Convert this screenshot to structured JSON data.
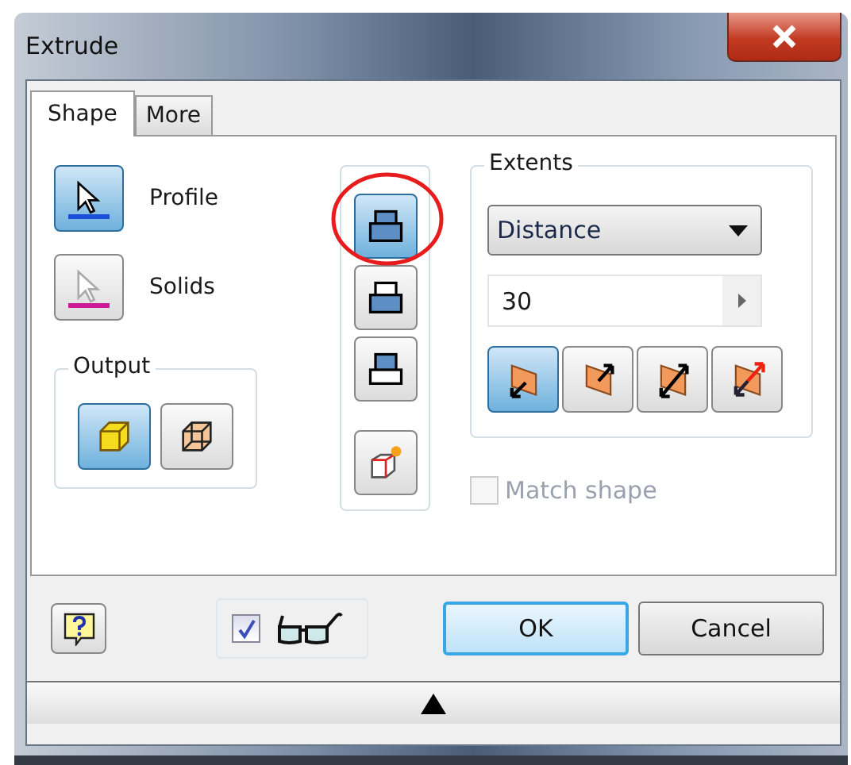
{
  "window": {
    "title": "Extrude"
  },
  "tabs": [
    {
      "label": "Shape",
      "selected": true
    },
    {
      "label": "More",
      "selected": false
    }
  ],
  "selectors": [
    {
      "label": "Profile",
      "selected": true,
      "color": "#1a4fd8"
    },
    {
      "label": "Solids",
      "selected": false,
      "color": "#cc1a99"
    }
  ],
  "output": {
    "title": "Output",
    "options": [
      {
        "kind": "solid",
        "selected": true
      },
      {
        "kind": "surface",
        "selected": false
      }
    ]
  },
  "operations": [
    {
      "kind": "join",
      "selected": true
    },
    {
      "kind": "cut",
      "selected": false
    },
    {
      "kind": "intersect",
      "selected": false
    },
    {
      "kind": "new-solid",
      "selected": false
    }
  ],
  "extents": {
    "title": "Extents",
    "method": "Distance",
    "distance": "30",
    "directions": [
      {
        "kind": "default",
        "selected": true
      },
      {
        "kind": "flipped",
        "selected": false
      },
      {
        "kind": "symmetric",
        "selected": false
      },
      {
        "kind": "asymmetric",
        "selected": false
      }
    ]
  },
  "match_shape": {
    "label": "Match shape",
    "checked": false,
    "disabled": true
  },
  "footer": {
    "preview_checked": true,
    "ok": "OK",
    "cancel": "Cancel"
  }
}
